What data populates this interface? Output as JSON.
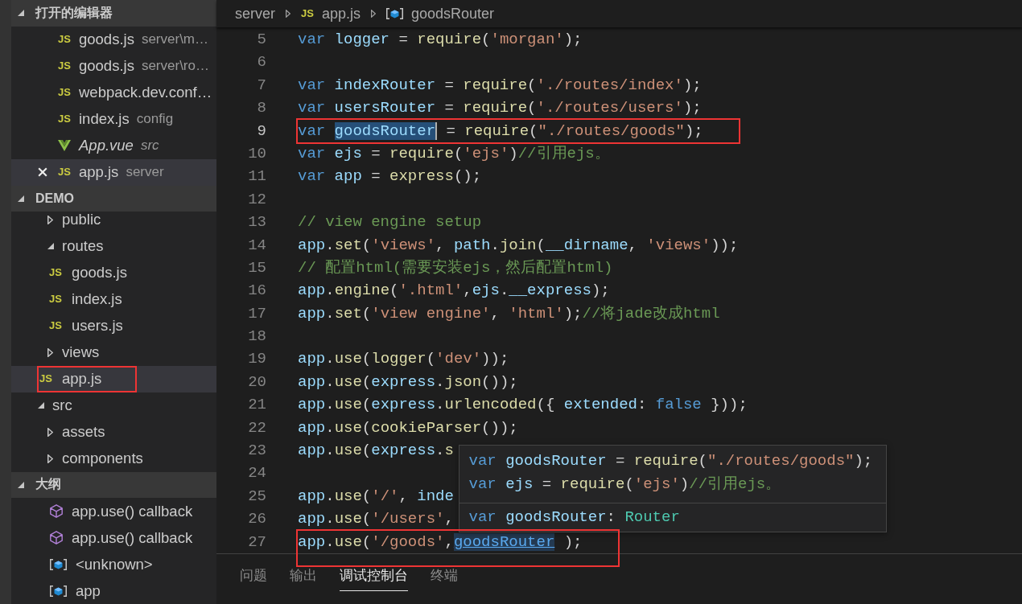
{
  "sidebar": {
    "sections": [
      {
        "title": "打开的编辑器",
        "kind": "open-editors",
        "expanded": true,
        "items": [
          {
            "label": "goods.js",
            "detail": "server\\m…",
            "kind": "file",
            "icon_text": "JS",
            "selected": false,
            "preview": false
          },
          {
            "label": "goods.js",
            "detail": "server\\ro…",
            "kind": "file",
            "icon_text": "JS",
            "selected": false,
            "preview": false
          },
          {
            "label": "webpack.dev.conf…",
            "kind": "file",
            "icon_text": "JS",
            "selected": false,
            "preview": false
          },
          {
            "label": "index.js",
            "detail": "config",
            "kind": "file",
            "icon_text": "JS",
            "selected": false,
            "preview": false
          },
          {
            "label": "App.vue",
            "detail": "src",
            "kind": "component",
            "selected": false,
            "preview": true
          },
          {
            "label": "app.js",
            "detail": "server",
            "kind": "file",
            "icon_text": "JS",
            "selected": true,
            "preview": false
          }
        ]
      },
      {
        "title": "DEMO",
        "kind": "explorer",
        "expanded": true,
        "items": [
          {
            "children": [
              {
                "label": "public",
                "kind": "folder",
                "expanded": false,
                "selected": false,
                "marked": false
              },
              {
                "label": "routes",
                "kind": "folder",
                "expanded": true,
                "selected": false,
                "marked": false,
                "children": [
                  {
                    "label": "goods.js",
                    "kind": "file",
                    "icon_text": "JS",
                    "selected": false,
                    "marked": false
                  },
                  {
                    "label": "index.js",
                    "kind": "file",
                    "icon_text": "JS",
                    "selected": false,
                    "marked": false
                  },
                  {
                    "label": "users.js",
                    "kind": "file",
                    "icon_text": "JS",
                    "selected": false,
                    "marked": false
                  }
                ]
              },
              {
                "label": "views",
                "kind": "folder",
                "expanded": false,
                "selected": false,
                "marked": false
              },
              {
                "label": "app.js",
                "kind": "file",
                "icon_text": "JS",
                "selected": true,
                "marked": true
              }
            ]
          },
          {
            "label": "src",
            "kind": "folder",
            "expanded": true,
            "selected": false,
            "marked": false,
            "children": [
              {
                "label": "assets",
                "kind": "folder",
                "expanded": false,
                "selected": false,
                "marked": false
              },
              {
                "label": "components",
                "kind": "folder",
                "expanded": false,
                "selected": false,
                "marked": false
              }
            ]
          }
        ]
      },
      {
        "title": "大纲",
        "kind": "outline",
        "expanded": true,
        "items": [
          {
            "label": "app.use() callback",
            "kind": "method"
          },
          {
            "label": "app.use() callback",
            "kind": "method"
          },
          {
            "label": "<unknown>",
            "kind": "variable"
          },
          {
            "label": "app",
            "kind": "variable"
          }
        ]
      }
    ]
  },
  "editor": {
    "breadcrumbs": [
      {
        "label": "server",
        "kind": "folder"
      },
      {
        "label": "app.js",
        "kind": "file",
        "icon_text": "JS"
      },
      {
        "label": "goodsRouter",
        "kind": "symbol"
      }
    ],
    "lines": [
      {
        "number": "5",
        "current": false,
        "marked": false,
        "tokens": [
          {
            "text": "var ",
            "kind": "keyword"
          },
          {
            "text": "logger",
            "kind": "variable"
          },
          {
            "text": " = ",
            "kind": "plain"
          },
          {
            "text": "require",
            "kind": "function"
          },
          {
            "text": "(",
            "kind": "plain"
          },
          {
            "text": "'morgan'",
            "kind": "string"
          },
          {
            "text": ");",
            "kind": "plain"
          }
        ]
      },
      {
        "number": "6",
        "current": false,
        "marked": false
      },
      {
        "number": "7",
        "current": false,
        "marked": false,
        "tokens": [
          {
            "text": "var ",
            "kind": "keyword"
          },
          {
            "text": "indexRouter",
            "kind": "variable"
          },
          {
            "text": " = ",
            "kind": "plain"
          },
          {
            "text": "require",
            "kind": "function"
          },
          {
            "text": "(",
            "kind": "plain"
          },
          {
            "text": "'./routes/index'",
            "kind": "string"
          },
          {
            "text": ");",
            "kind": "plain"
          }
        ]
      },
      {
        "number": "8",
        "current": false,
        "marked": false,
        "tokens": [
          {
            "text": "var ",
            "kind": "keyword"
          },
          {
            "text": "usersRouter",
            "kind": "variable"
          },
          {
            "text": " = ",
            "kind": "plain"
          },
          {
            "text": "require",
            "kind": "function"
          },
          {
            "text": "(",
            "kind": "plain"
          },
          {
            "text": "'./routes/users'",
            "kind": "string"
          },
          {
            "text": ");",
            "kind": "plain"
          }
        ]
      },
      {
        "number": "9",
        "current": true,
        "marked": true,
        "tokens": [
          {
            "text": "var ",
            "kind": "keyword"
          },
          {
            "text": "goodsRouter",
            "kind": "selection"
          },
          {
            "text": " = ",
            "kind": "plain"
          },
          {
            "text": "require",
            "kind": "function"
          },
          {
            "text": "(",
            "kind": "plain"
          },
          {
            "text": "\"./routes/goods\"",
            "kind": "string"
          },
          {
            "text": ");",
            "kind": "plain"
          }
        ]
      },
      {
        "number": "10",
        "current": false,
        "marked": false,
        "tokens": [
          {
            "text": "var ",
            "kind": "keyword"
          },
          {
            "text": "ejs",
            "kind": "variable"
          },
          {
            "text": " = ",
            "kind": "plain"
          },
          {
            "text": "require",
            "kind": "function"
          },
          {
            "text": "(",
            "kind": "plain"
          },
          {
            "text": "'ejs'",
            "kind": "string"
          },
          {
            "text": ")",
            "kind": "plain"
          },
          {
            "text": "//引用ejs。",
            "kind": "comment"
          }
        ]
      },
      {
        "number": "11",
        "current": false,
        "marked": false,
        "tokens": [
          {
            "text": "var ",
            "kind": "keyword"
          },
          {
            "text": "app",
            "kind": "variable"
          },
          {
            "text": " = ",
            "kind": "plain"
          },
          {
            "text": "express",
            "kind": "function"
          },
          {
            "text": "();",
            "kind": "plain"
          }
        ]
      },
      {
        "number": "12",
        "current": false,
        "marked": false
      },
      {
        "number": "13",
        "current": false,
        "marked": false,
        "tokens": [
          {
            "text": "// view engine setup",
            "kind": "comment"
          }
        ]
      },
      {
        "number": "14",
        "current": false,
        "marked": false,
        "tokens": [
          {
            "text": "app",
            "kind": "variable"
          },
          {
            "text": ".",
            "kind": "plain"
          },
          {
            "text": "set",
            "kind": "function"
          },
          {
            "text": "(",
            "kind": "plain"
          },
          {
            "text": "'views'",
            "kind": "string"
          },
          {
            "text": ", ",
            "kind": "plain"
          },
          {
            "text": "path",
            "kind": "variable"
          },
          {
            "text": ".",
            "kind": "plain"
          },
          {
            "text": "join",
            "kind": "function"
          },
          {
            "text": "(",
            "kind": "plain"
          },
          {
            "text": "__dirname",
            "kind": "variable"
          },
          {
            "text": ", ",
            "kind": "plain"
          },
          {
            "text": "'views'",
            "kind": "string"
          },
          {
            "text": "));",
            "kind": "plain"
          }
        ]
      },
      {
        "number": "15",
        "current": false,
        "marked": false,
        "tokens": [
          {
            "text": "// 配置html(需要安装ejs，然后配置html)",
            "kind": "comment"
          }
        ]
      },
      {
        "number": "16",
        "current": false,
        "marked": false,
        "tokens": [
          {
            "text": "app",
            "kind": "variable"
          },
          {
            "text": ".",
            "kind": "plain"
          },
          {
            "text": "engine",
            "kind": "function"
          },
          {
            "text": "(",
            "kind": "plain"
          },
          {
            "text": "'.html'",
            "kind": "string"
          },
          {
            "text": ",",
            "kind": "plain"
          },
          {
            "text": "ejs",
            "kind": "variable"
          },
          {
            "text": ".",
            "kind": "plain"
          },
          {
            "text": "__express",
            "kind": "variable"
          },
          {
            "text": ");",
            "kind": "plain"
          }
        ]
      },
      {
        "number": "17",
        "current": false,
        "marked": false,
        "tokens": [
          {
            "text": "app",
            "kind": "variable"
          },
          {
            "text": ".",
            "kind": "plain"
          },
          {
            "text": "set",
            "kind": "function"
          },
          {
            "text": "(",
            "kind": "plain"
          },
          {
            "text": "'view engine'",
            "kind": "string"
          },
          {
            "text": ", ",
            "kind": "plain"
          },
          {
            "text": "'html'",
            "kind": "string"
          },
          {
            "text": ");",
            "kind": "plain"
          },
          {
            "text": "//将jade改成html",
            "kind": "comment"
          }
        ]
      },
      {
        "number": "18",
        "current": false,
        "marked": false
      },
      {
        "number": "19",
        "current": false,
        "marked": false,
        "tokens": [
          {
            "text": "app",
            "kind": "variable"
          },
          {
            "text": ".",
            "kind": "plain"
          },
          {
            "text": "use",
            "kind": "function"
          },
          {
            "text": "(",
            "kind": "plain"
          },
          {
            "text": "logger",
            "kind": "function"
          },
          {
            "text": "(",
            "kind": "plain"
          },
          {
            "text": "'dev'",
            "kind": "string"
          },
          {
            "text": "));",
            "kind": "plain"
          }
        ]
      },
      {
        "number": "20",
        "current": false,
        "marked": false,
        "tokens": [
          {
            "text": "app",
            "kind": "variable"
          },
          {
            "text": ".",
            "kind": "plain"
          },
          {
            "text": "use",
            "kind": "function"
          },
          {
            "text": "(",
            "kind": "plain"
          },
          {
            "text": "express",
            "kind": "variable"
          },
          {
            "text": ".",
            "kind": "plain"
          },
          {
            "text": "json",
            "kind": "function"
          },
          {
            "text": "());",
            "kind": "plain"
          }
        ]
      },
      {
        "number": "21",
        "current": false,
        "marked": false,
        "tokens": [
          {
            "text": "app",
            "kind": "variable"
          },
          {
            "text": ".",
            "kind": "plain"
          },
          {
            "text": "use",
            "kind": "function"
          },
          {
            "text": "(",
            "kind": "plain"
          },
          {
            "text": "express",
            "kind": "variable"
          },
          {
            "text": ".",
            "kind": "plain"
          },
          {
            "text": "urlencoded",
            "kind": "function"
          },
          {
            "text": "({ ",
            "kind": "plain"
          },
          {
            "text": "extended",
            "kind": "variable"
          },
          {
            "text": ": ",
            "kind": "plain"
          },
          {
            "text": "false",
            "kind": "keyword"
          },
          {
            "text": " }));",
            "kind": "plain"
          }
        ]
      },
      {
        "number": "22",
        "current": false,
        "marked": false,
        "tokens": [
          {
            "text": "app",
            "kind": "variable"
          },
          {
            "text": ".",
            "kind": "plain"
          },
          {
            "text": "use",
            "kind": "function"
          },
          {
            "text": "(",
            "kind": "plain"
          },
          {
            "text": "cookieParser",
            "kind": "function"
          },
          {
            "text": "());",
            "kind": "plain"
          }
        ]
      },
      {
        "number": "23",
        "current": false,
        "marked": false,
        "tokens": [
          {
            "text": "app",
            "kind": "variable"
          },
          {
            "text": ".",
            "kind": "plain"
          },
          {
            "text": "use",
            "kind": "function"
          },
          {
            "text": "(",
            "kind": "plain"
          },
          {
            "text": "express",
            "kind": "variable"
          },
          {
            "text": ".",
            "kind": "plain"
          },
          {
            "text": "s",
            "kind": "function"
          }
        ]
      },
      {
        "number": "24",
        "current": false,
        "marked": false
      },
      {
        "number": "25",
        "current": false,
        "marked": false,
        "tokens": [
          {
            "text": "app",
            "kind": "variable"
          },
          {
            "text": ".",
            "kind": "plain"
          },
          {
            "text": "use",
            "kind": "function"
          },
          {
            "text": "(",
            "kind": "plain"
          },
          {
            "text": "'/'",
            "kind": "string"
          },
          {
            "text": ", ",
            "kind": "plain"
          },
          {
            "text": "inde",
            "kind": "variable"
          }
        ]
      },
      {
        "number": "26",
        "current": false,
        "marked": false,
        "tokens": [
          {
            "text": "app",
            "kind": "variable"
          },
          {
            "text": ".",
            "kind": "plain"
          },
          {
            "text": "use",
            "kind": "function"
          },
          {
            "text": "(",
            "kind": "plain"
          },
          {
            "text": "'/users'",
            "kind": "string"
          },
          {
            "text": ",",
            "kind": "plain"
          }
        ]
      },
      {
        "number": "27",
        "current": false,
        "marked": true,
        "tokens": [
          {
            "text": "app",
            "kind": "variable"
          },
          {
            "text": ".",
            "kind": "plain"
          },
          {
            "text": "use",
            "kind": "function"
          },
          {
            "text": "(",
            "kind": "plain"
          },
          {
            "text": "'/goods'",
            "kind": "string"
          },
          {
            "text": ",",
            "kind": "plain"
          },
          {
            "text": "goodsRouter",
            "kind": "link"
          },
          {
            "text": " );",
            "kind": "plain"
          }
        ]
      }
    ],
    "hover": {
      "code": [
        {
          "tokens": [
            {
              "text": "var ",
              "kind": "keyword"
            },
            {
              "text": "goodsRouter",
              "kind": "variable"
            },
            {
              "text": " = ",
              "kind": "plain"
            },
            {
              "text": "require",
              "kind": "function"
            },
            {
              "text": "(",
              "kind": "plain"
            },
            {
              "text": "\"./routes/goods\"",
              "kind": "string"
            },
            {
              "text": ");",
              "kind": "plain"
            }
          ]
        },
        {
          "tokens": [
            {
              "text": "var ",
              "kind": "keyword"
            },
            {
              "text": "ejs",
              "kind": "variable"
            },
            {
              "text": " = ",
              "kind": "plain"
            },
            {
              "text": "require",
              "kind": "function"
            },
            {
              "text": "(",
              "kind": "plain"
            },
            {
              "text": "'ejs'",
              "kind": "string"
            },
            {
              "text": ")",
              "kind": "plain"
            },
            {
              "text": "//引用ejs。",
              "kind": "comment"
            }
          ]
        }
      ],
      "signature": {
        "tokens": [
          {
            "text": "var ",
            "kind": "keyword"
          },
          {
            "text": "goodsRouter",
            "kind": "variable"
          },
          {
            "text": ": ",
            "kind": "plain"
          },
          {
            "text": "Router",
            "kind": "type"
          }
        ]
      }
    }
  },
  "panel": {
    "tabs": [
      {
        "label": "问题",
        "selected": false
      },
      {
        "label": "输出",
        "selected": false
      },
      {
        "label": "调试控制台",
        "selected": true
      },
      {
        "label": "终端",
        "selected": false
      }
    ]
  }
}
